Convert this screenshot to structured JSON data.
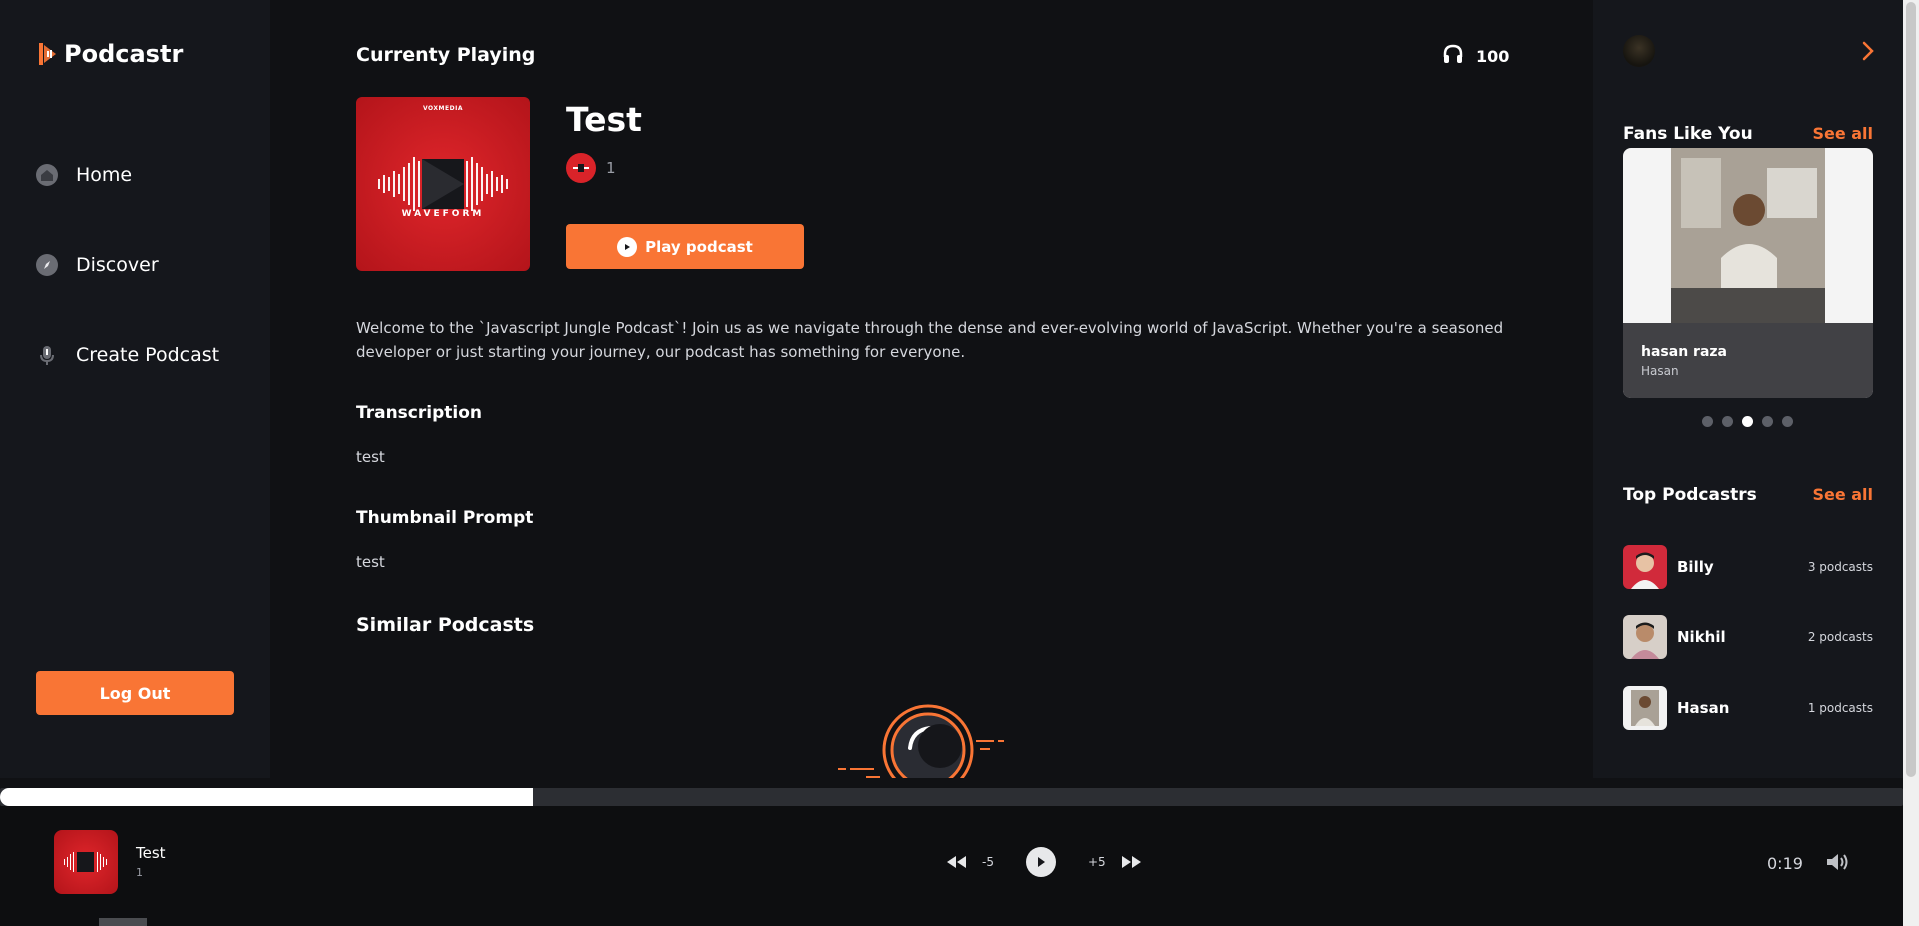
{
  "app": {
    "name": "Podcastr",
    "accent": "#f97535"
  },
  "sidebar": {
    "items": [
      {
        "label": "Home",
        "icon": "home-icon"
      },
      {
        "label": "Discover",
        "icon": "compass-icon"
      },
      {
        "label": "Create Podcast",
        "icon": "microphone-icon"
      }
    ],
    "logout_label": "Log Out"
  },
  "main": {
    "heading": "Currenty Playing",
    "listeners": "100",
    "podcast": {
      "title": "Test",
      "author_count": "1",
      "cover_brand": "VOXMEDIA",
      "cover_label": "WAVEFORM",
      "play_label": "Play podcast",
      "description": "Welcome to the `Javascript Jungle Podcast`! Join us as we navigate through the dense and ever-evolving world of JavaScript. Whether you're a seasoned developer or just starting your journey, our podcast has something for everyone."
    },
    "transcription": {
      "title": "Transcription",
      "text": "test"
    },
    "thumbnail_prompt": {
      "title": "Thumbnail Prompt",
      "text": "test"
    },
    "similar_title": "Similar Podcasts"
  },
  "right": {
    "fans": {
      "title": "Fans Like You",
      "see_all": "See all",
      "card": {
        "name": "hasan raza",
        "username": "Hasan"
      },
      "dots": 5,
      "active_dot": 3
    },
    "top": {
      "title": "Top Podcastrs",
      "see_all": "See all",
      "items": [
        {
          "name": "Billy",
          "count": "3 podcasts"
        },
        {
          "name": "Nikhil",
          "count": "2 podcasts"
        },
        {
          "name": "Hasan",
          "count": "1 podcasts"
        }
      ]
    }
  },
  "player": {
    "title": "Test",
    "subtitle": "1",
    "rewind_label": "-5",
    "forward_label": "+5",
    "time": "0:19",
    "progress": 0.28
  }
}
